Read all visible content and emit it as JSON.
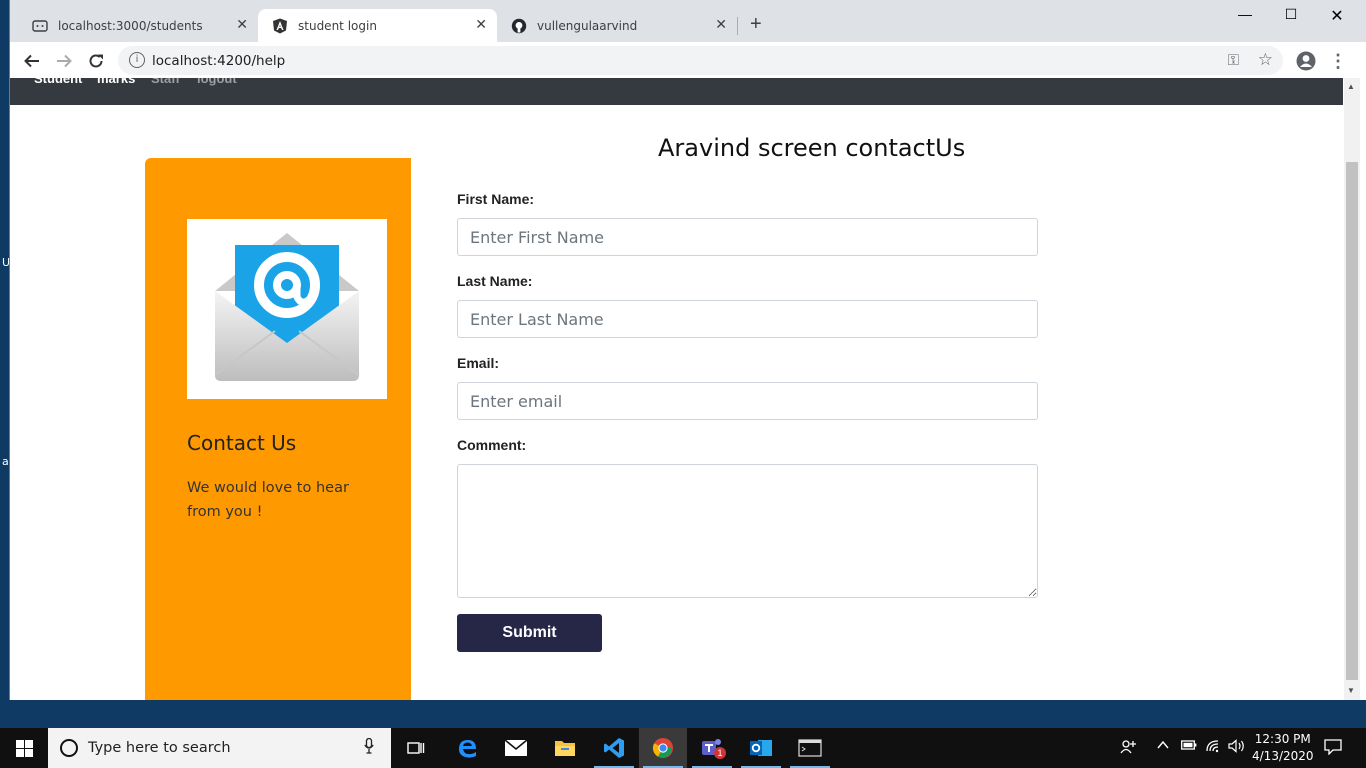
{
  "desktop": {
    "edge_letters": [
      "U",
      "a"
    ]
  },
  "browser": {
    "tabs": [
      {
        "title": "localhost:3000/students",
        "icon": "local-app-icon",
        "active": false
      },
      {
        "title": "student login",
        "icon": "angular-icon",
        "active": true
      },
      {
        "title": "vullengulaarvind",
        "icon": "github-icon",
        "active": false
      }
    ],
    "new_tab_icon": "plus-icon",
    "window_controls": [
      "minimize-icon",
      "maximize-icon",
      "close-icon"
    ],
    "address": "localhost:4200/help"
  },
  "nav": {
    "links": [
      "Student",
      "marks",
      "Staff",
      "logout"
    ]
  },
  "page": {
    "title": "Aravind screen contactUs",
    "sidebar": {
      "image_icon": "email-envelope-icon",
      "heading": "Contact Us",
      "text": "We would love to hear from you !"
    },
    "form": {
      "first_name_label": "First Name:",
      "first_name_placeholder": "Enter First Name",
      "first_name_value": "",
      "last_name_label": "Last Name:",
      "last_name_placeholder": "Enter Last Name",
      "last_name_value": "",
      "email_label": "Email:",
      "email_placeholder": "Enter email",
      "email_value": "",
      "comment_label": "Comment:",
      "comment_value": "",
      "submit_label": "Submit"
    }
  },
  "taskbar": {
    "search_placeholder": "Type here to search",
    "apps": [
      "task-view-icon",
      "edge-icon",
      "mail-icon",
      "file-explorer-icon",
      "vscode-icon",
      "chrome-icon",
      "teams-icon",
      "outlook-icon",
      "terminal-icon"
    ],
    "teams_badge": "1",
    "time": "12:30 PM",
    "date": "4/13/2020"
  },
  "colors": {
    "sidebar": "#ff9900",
    "navbar": "#343a40",
    "submit": "#262646"
  }
}
